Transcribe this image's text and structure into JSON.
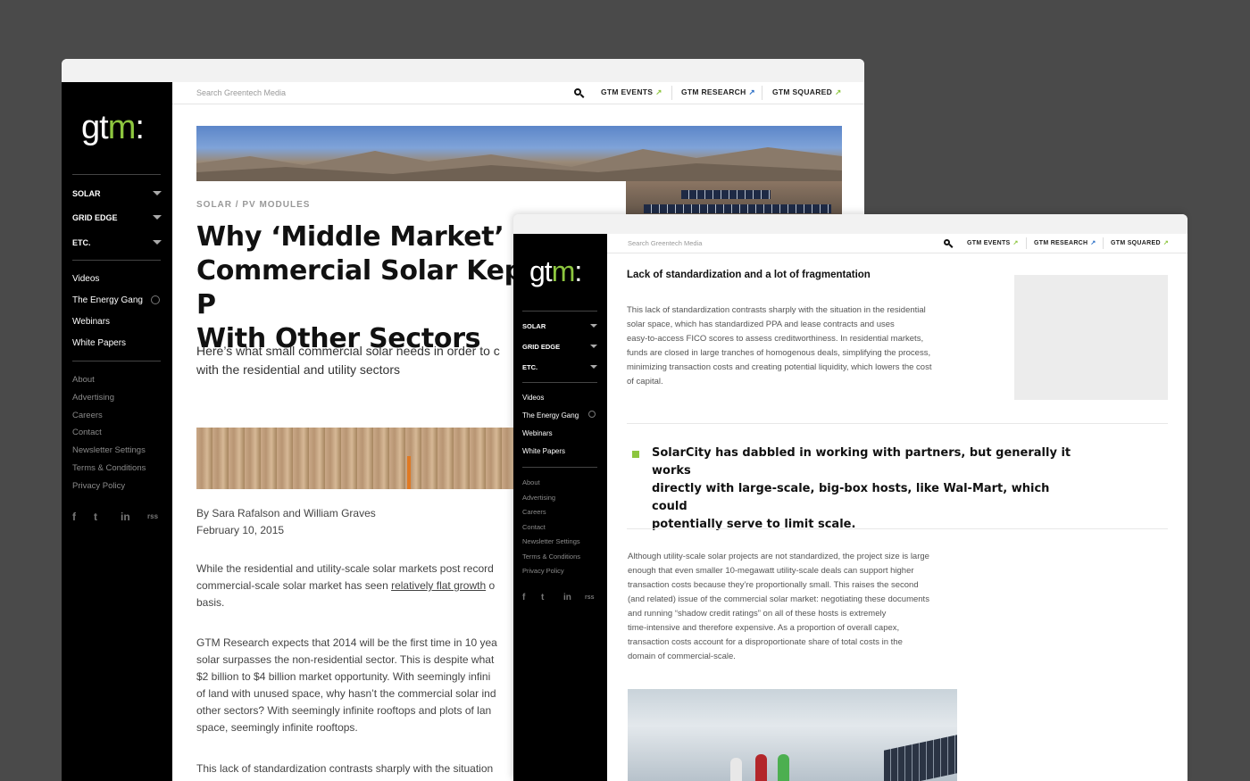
{
  "brand": {
    "logo_main": "gt",
    "logo_accent": "m",
    "logo_colon": ":",
    "accent_color": "#8dc63f"
  },
  "topbar": {
    "search_placeholder": "Search Greentech Media",
    "links": [
      {
        "label": "GTM EVENTS",
        "arrow": "↗"
      },
      {
        "label": "GTM RESEARCH",
        "arrow": "↗"
      },
      {
        "label": "GTM SQUARED",
        "arrow": "↗"
      }
    ]
  },
  "sidebar": {
    "categories": [
      "SOLAR",
      "GRID EDGE",
      "ETC."
    ],
    "links": [
      "Videos",
      "The Energy Gang",
      "Webinars",
      "White Papers"
    ],
    "footer": [
      "About",
      "Advertising",
      "Careers",
      "Contact",
      "Newsletter Settings",
      "Terms & Conditions",
      "Privacy Policy"
    ],
    "social": [
      "f",
      "t",
      "in",
      "rss"
    ]
  },
  "article": {
    "kicker": "SOLAR / PV MODULES",
    "headline": [
      "Why ‘Middle Market’",
      "Commercial Solar Kept P",
      "With Other Sectors"
    ],
    "dek": [
      "Here’s what small commercial solar needs in order to c",
      "with the residential and utility sectors"
    ],
    "byline": "By Sara Rafalson and William Graves",
    "date": "February 10, 2015",
    "p1": {
      "line1": "While the residential and utility-scale solar markets post record",
      "line2_pre": "commercial-scale solar market has seen ",
      "line2_link": "relatively flat growth",
      "line2_post": " o",
      "line3": "basis."
    },
    "p2": [
      "GTM Research expects that 2014 will be the first time in 10 yea",
      "solar surpasses the non-residential sector. This is despite what",
      "$2 billion to $4 billion market opportunity. With seemingly infini",
      "of land with unused space, why hasn’t the commercial solar ind",
      "other sectors? With seemingly infinite rooftops and plots of lan",
      "space, seemingly infinite rooftops."
    ],
    "p3": "This lack of standardization contrasts sharply with the situation"
  },
  "detail": {
    "heading": "Lack of standardization and a lot of fragmentation",
    "para1": [
      "This lack of standardization contrasts sharply with the situation in the residential",
      "solar space, which has standardized PPA and lease contracts and uses",
      "easy-to-access FICO scores to assess creditworthiness. In residential markets,",
      "funds are closed in large tranches of homogenous deals, simplifying the process,",
      "minimizing transaction costs and creating potential liquidity, which lowers the cost",
      "of capital."
    ],
    "pullquote": [
      "SolarCity has dabbled in working with partners, but generally it works",
      "directly with large-scale, big-box hosts, like Wal-Mart, which could",
      "potentially serve to limit scale."
    ],
    "para2": [
      "Although utility-scale solar projects are not standardized, the project size is large",
      "enough that even smaller 10-megawatt utility-scale deals can support higher",
      "transaction costs because they’re proportionally small. This raises the second",
      "(and related) issue of the commercial solar market: negotiating these documents",
      "and running “shadow credit ratings” on all of these hosts is extremely",
      "time-intensive and therefore expensive. As a proportion of overall capex,",
      "transaction costs account for a disproportionate share of total costs in the",
      "domain of commercial-scale."
    ]
  }
}
